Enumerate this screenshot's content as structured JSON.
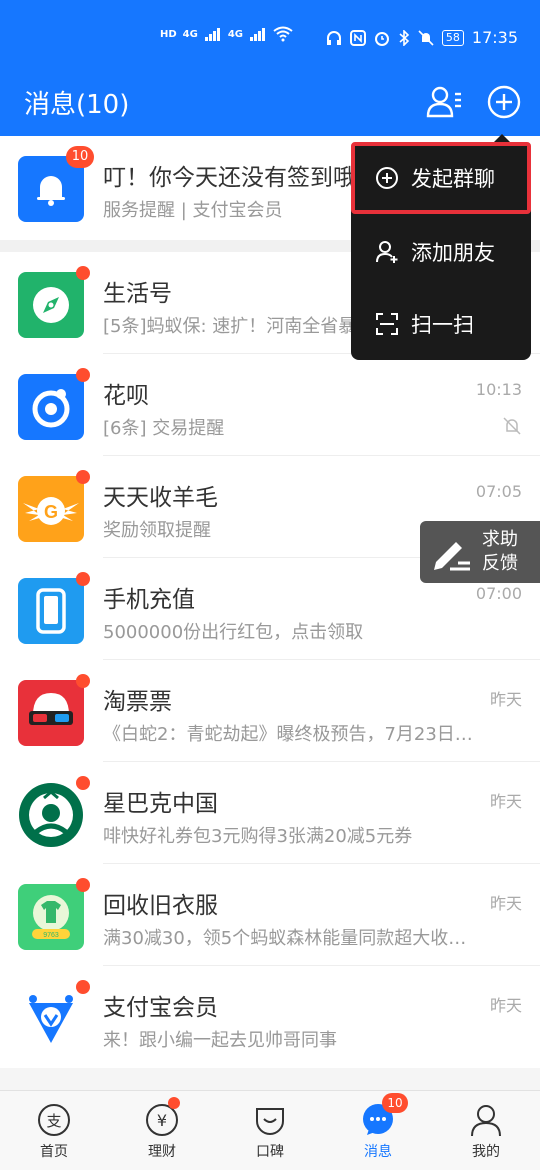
{
  "status_bar": {
    "left_labels": [
      "HD",
      "4G",
      "4G"
    ],
    "battery": "58",
    "time": "17:35"
  },
  "header": {
    "title": "消息(10)",
    "icons": [
      "contacts-icon",
      "plus-circle-icon"
    ]
  },
  "messages": [
    {
      "name": "叮！你今天还没有签到哦",
      "sub": "服务提醒 | 支付宝会员",
      "time": "",
      "badge": "10",
      "avatar_color": "#1677ff",
      "icon": "bell-icon"
    },
    {
      "name": "生活号",
      "sub": "[5条]蚂蚁保: 速扩！河南全省暴雨捐赠保险",
      "time": "",
      "dot": true,
      "avatar_color": "#21b36b",
      "icon": "compass-icon"
    },
    {
      "name": "花呗",
      "sub": "[6条] 交易提醒",
      "time": "10:13",
      "dot": true,
      "muted": true,
      "avatar_color": "#1677ff",
      "icon": "huabei-icon"
    },
    {
      "name": "天天收羊毛",
      "sub": "奖励领取提醒",
      "time": "07:05",
      "dot": true,
      "avatar_color": "#ffa21a",
      "icon": "g-wings-icon"
    },
    {
      "name": "手机充值",
      "sub": "5000000份出行红包，点击领取",
      "time": "07:00",
      "dot": true,
      "avatar_color": "#1f9bf0",
      "icon": "phone-icon"
    },
    {
      "name": "淘票票",
      "sub": "《白蛇2：青蛇劫起》曝终极预告，7月23日…",
      "time": "昨天",
      "dot": true,
      "avatar_color": "#e8313a",
      "icon": "3d-glasses-icon"
    },
    {
      "name": "星巴克中国",
      "sub": "啡快好礼券包3元购得3张满20减5元券",
      "time": "昨天",
      "dot": true,
      "avatar_color": "#00704a",
      "icon": "starbucks-logo-icon"
    },
    {
      "name": "回收旧衣服",
      "sub": "满30减30，领5个蚂蚁森林能量同款超大收…",
      "time": "昨天",
      "dot": true,
      "avatar_color": "#3fcf7a",
      "icon": "recycle-shirt-icon"
    },
    {
      "name": "支付宝会员",
      "sub": "来！跟小编一起去见帅哥同事",
      "time": "昨天",
      "dot": true,
      "avatar_color": "#1677ff",
      "icon": "vip-v-icon"
    }
  ],
  "menu": {
    "items": [
      {
        "label": "发起群聊",
        "icon": "plus-circle-icon",
        "highlighted": true
      },
      {
        "label": "添加朋友",
        "icon": "add-user-icon"
      },
      {
        "label": "扫一扫",
        "icon": "scan-icon"
      }
    ]
  },
  "feedback": {
    "line1": "求助",
    "line2": "反馈"
  },
  "tabbar": {
    "tabs": [
      {
        "label": "首页",
        "icon": "alipay-home-icon"
      },
      {
        "label": "理财",
        "icon": "yuan-icon",
        "dot": true
      },
      {
        "label": "口碑",
        "icon": "koubei-icon"
      },
      {
        "label": "消息",
        "icon": "message-bubble-icon",
        "badge": "10",
        "active": true
      },
      {
        "label": "我的",
        "icon": "person-icon"
      }
    ]
  },
  "colors": {
    "brand": "#1677ff",
    "badge": "#ff4d2e",
    "highlight": "#e8313a"
  }
}
